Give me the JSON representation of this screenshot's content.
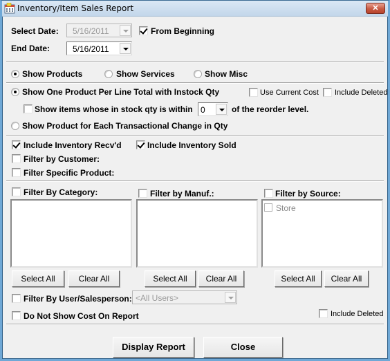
{
  "window": {
    "title": "Inventory/Item Sales Report",
    "close_label": "✕"
  },
  "dates": {
    "select_date_label": "Select Date:",
    "select_date_value": "5/16/2011",
    "from_beginning_label": "From Beginning",
    "from_beginning_checked": true,
    "end_date_label": "End Date:",
    "end_date_value": "5/16/2011"
  },
  "show_type": {
    "options": [
      {
        "label": "Show Products",
        "selected": true
      },
      {
        "label": "Show Services",
        "selected": false
      },
      {
        "label": "Show Misc",
        "selected": false
      }
    ]
  },
  "layout_mode": {
    "one_per_line_label": "Show One Product Per Line Total with Instock Qty",
    "one_per_line_selected": true,
    "use_current_cost_label": "Use Current Cost",
    "include_deleted_label": "Include Deleted",
    "within_reorder_prefix": "Show items whose in stock qty is within",
    "within_reorder_value": "0",
    "within_reorder_suffix": "of the reorder level.",
    "transactional_label": "Show Product for Each Transactional Change in Qty",
    "transactional_selected": false
  },
  "filters": {
    "include_recvd_label": "Include Inventory Recv'd",
    "include_recvd_checked": true,
    "include_sold_label": "Include Inventory Sold",
    "include_sold_checked": true,
    "filter_customer_label": "Filter by Customer:",
    "filter_product_label": "Filter Specific Product:"
  },
  "lists": {
    "category": {
      "label": "Filter By Category:",
      "items": []
    },
    "manuf": {
      "label": "Filter by Manuf.:",
      "items": []
    },
    "source": {
      "label": "Filter by Source:",
      "items": [
        "Store"
      ]
    },
    "select_all_label": "Select All",
    "clear_all_label": "Clear All"
  },
  "user_filter": {
    "label": "Filter By User/Salesperson:",
    "value": "<All Users>",
    "no_cost_label": "Do Not Show Cost On Report",
    "include_deleted_label": "Include Deleted"
  },
  "actions": {
    "display_report_label": "Display Report",
    "close_label": "Close"
  }
}
